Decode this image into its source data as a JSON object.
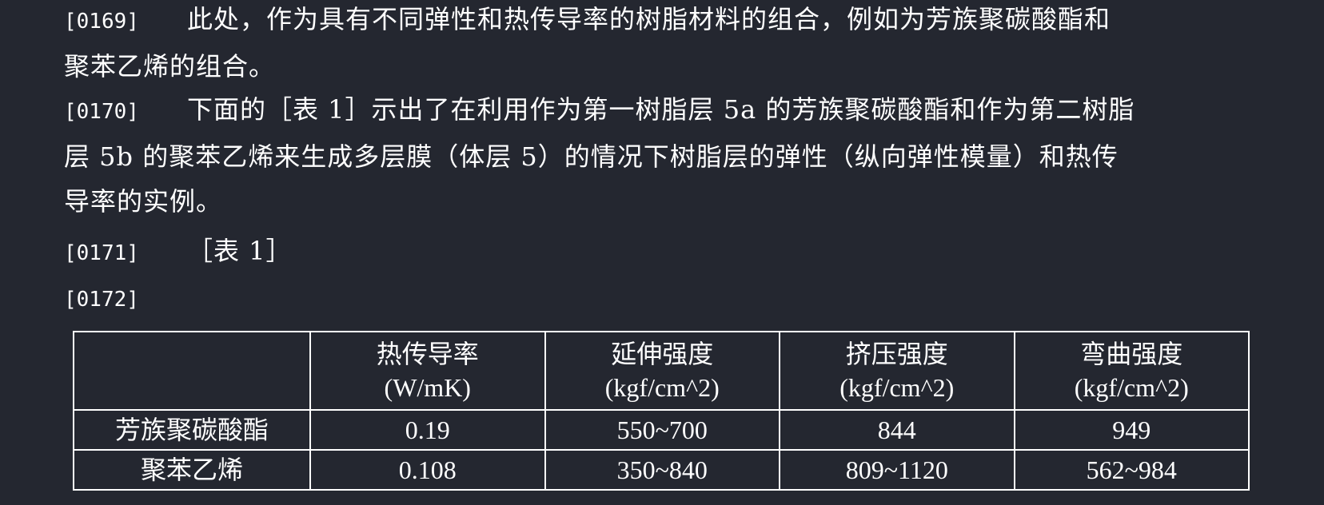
{
  "paragraphs": [
    {
      "num": "[0169]",
      "lines": [
        "此处，作为具有不同弹性和热传导率的树脂材料的组合，例如为芳族聚碳酸酯和",
        "聚苯乙烯的组合。"
      ]
    },
    {
      "num": "[0170]",
      "lines": [
        "下面的［表 1］示出了在利用作为第一树脂层 5a 的芳族聚碳酸酯和作为第二树脂",
        "层 5b 的聚苯乙烯来生成多层膜（体层 5）的情况下树脂层的弹性（纵向弹性模量）和热传",
        "导率的实例。"
      ]
    },
    {
      "num": "[0171]",
      "lines": [
        "［表 1］"
      ]
    },
    {
      "num": "[0172]",
      "lines": [
        ""
      ]
    }
  ],
  "table": {
    "headers": [
      {
        "name": "",
        "unit": ""
      },
      {
        "name": "热传导率",
        "unit": "(W/mK)"
      },
      {
        "name": "延伸强度",
        "unit": "(kgf/cm^2)"
      },
      {
        "name": "挤压强度",
        "unit": "(kgf/cm^2)"
      },
      {
        "name": "弯曲强度",
        "unit": "(kgf/cm^2)"
      }
    ],
    "rows": [
      [
        "芳族聚碳酸酯",
        "0.19",
        "550~700",
        "844",
        "949"
      ],
      [
        "聚苯乙烯",
        "0.108",
        "350~840",
        "809~1120",
        "562~984"
      ]
    ]
  },
  "colors": {
    "background": "#242730",
    "text": "#ffffff"
  }
}
